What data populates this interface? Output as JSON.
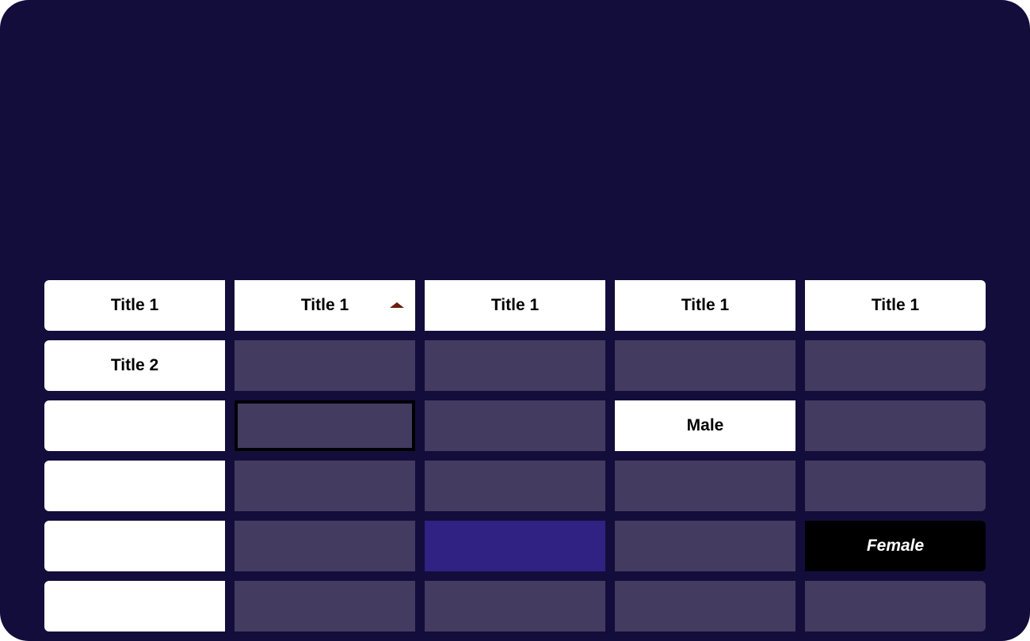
{
  "table": {
    "headers": [
      "Title 1",
      "Title 1",
      "Title 1",
      "Title 1",
      "Title 1"
    ],
    "sorted_column_index": 1,
    "sort_direction": "ascending",
    "rows": [
      [
        "Title 2",
        "",
        "",
        "",
        ""
      ],
      [
        "",
        "",
        "",
        "Male",
        ""
      ],
      [
        "",
        "",
        "",
        "",
        ""
      ],
      [
        "",
        "",
        "",
        "",
        "Female"
      ],
      [
        "",
        "",
        "",
        "",
        ""
      ]
    ]
  },
  "colors": {
    "background": "#130d3b",
    "cell": "#433c60",
    "header": "#ffffff",
    "highlight": "#2f2282",
    "sort_arrow": "#6b1d0a"
  }
}
